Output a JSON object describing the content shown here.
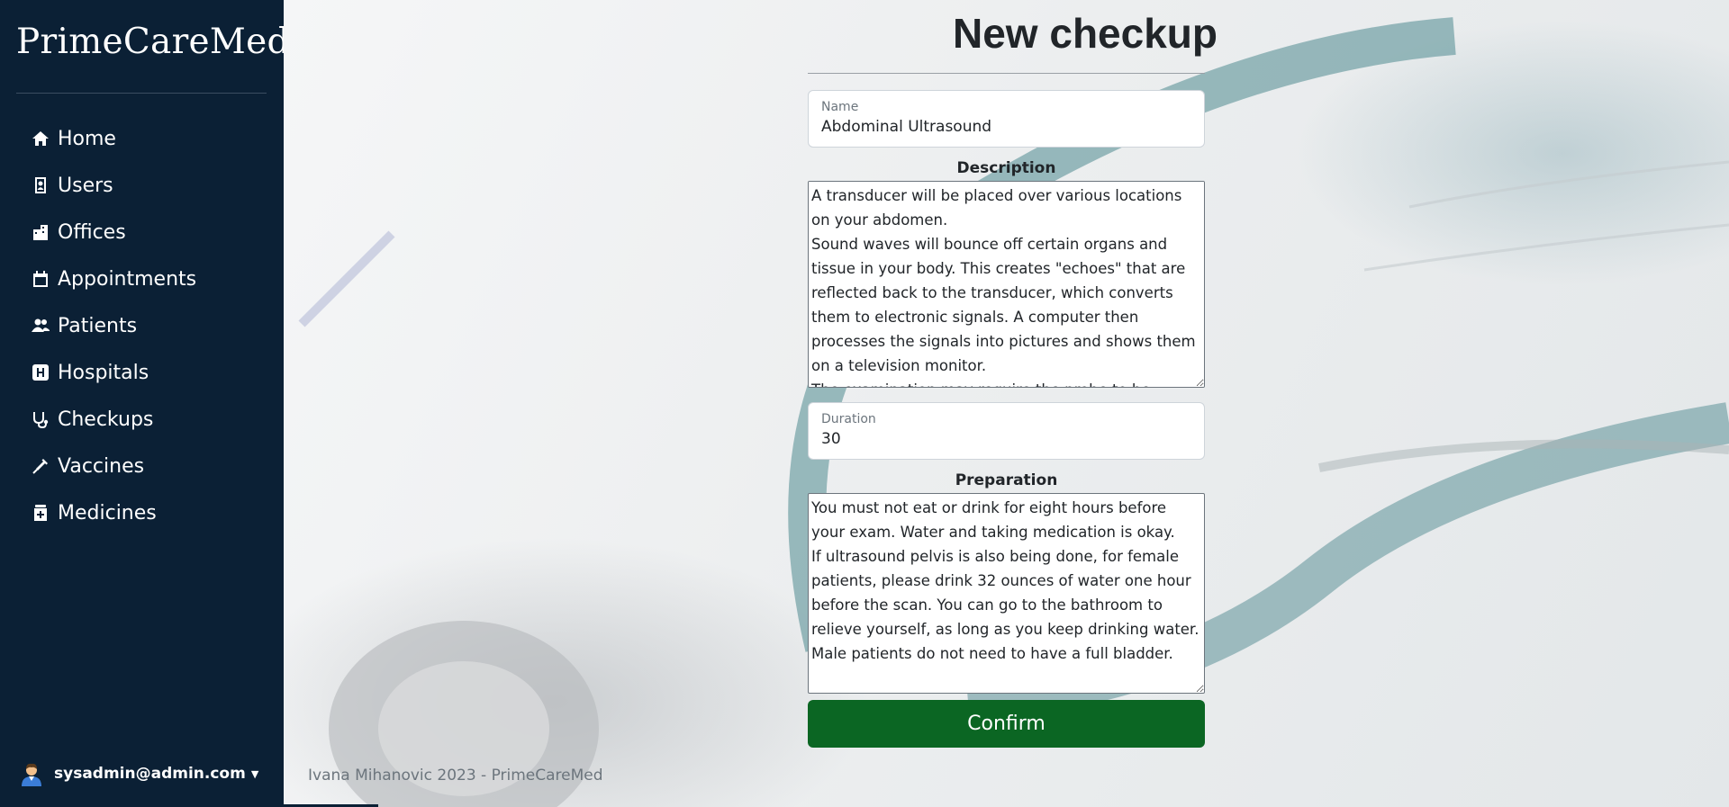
{
  "sidebar": {
    "brand": "PrimeCareMed",
    "items": [
      {
        "label": "Home",
        "icon": "house-icon"
      },
      {
        "label": "Users",
        "icon": "id-badge-icon"
      },
      {
        "label": "Offices",
        "icon": "buildings-icon"
      },
      {
        "label": "Appointments",
        "icon": "calendar-icon"
      },
      {
        "label": "Patients",
        "icon": "people-icon"
      },
      {
        "label": "Hospitals",
        "icon": "hospital-h-icon"
      },
      {
        "label": "Checkups",
        "icon": "stethoscope-icon"
      },
      {
        "label": "Vaccines",
        "icon": "syringe-icon"
      },
      {
        "label": "Medicines",
        "icon": "capsule-icon"
      }
    ],
    "user": "sysadmin@admin.com"
  },
  "form": {
    "title": "New checkup",
    "name_label": "Name",
    "name_value": "Abdominal Ultrasound",
    "description_label": "Description",
    "description_value": "A transducer will be placed over various locations on your abdomen.\nSound waves will bounce off certain organs and tissue in your body. This creates \"echoes\" that are reflected back to the transducer, which converts them to electronic signals. A computer then processes the signals into pictures and shows them on a television monitor.\nThe examination may require the probe to be applied",
    "duration_label": "Duration",
    "duration_value": "30",
    "preparation_label": "Preparation",
    "preparation_value": "You must not eat or drink for eight hours before your exam. Water and taking medication is okay.\nIf ultrasound pelvis is also being done, for female patients, please drink 32 ounces of water one hour before the scan. You can go to the bathroom to relieve yourself, as long as you keep drinking water. Male patients do not need to have a full bladder.",
    "confirm_label": "Confirm"
  },
  "footer": "Ivana Mihanovic 2023 - PrimeCareMed",
  "colors": {
    "sidebar": "#0b2035",
    "confirm": "#0b6623"
  }
}
